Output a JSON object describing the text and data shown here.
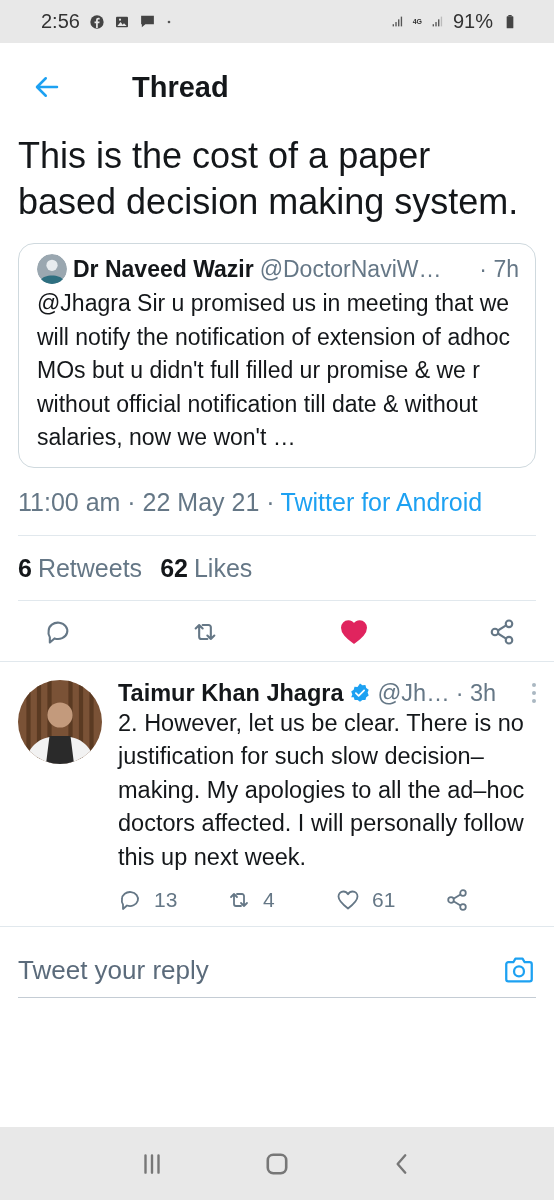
{
  "status_bar": {
    "time": "2:56",
    "network": "4G",
    "battery": "91%"
  },
  "header": {
    "title": "Thread"
  },
  "main_tweet": {
    "text": "This is the cost of a paper based decision making system.",
    "quoted_tweet": {
      "name": "Dr Naveed Wazir",
      "handle": "@DoctorNaviW…",
      "time": "· 7h",
      "text": "@Jhagra Sir u promised us in meeting that we will notify the notification of extension of adhoc MOs but u didn't full filled ur promise & we r without official notification till date & without salaries, now we won't …"
    },
    "meta": {
      "timestamp": "11:00 am · 22 May 21 ·",
      "source": "Twitter for Android"
    },
    "stats": [
      {
        "count": "6",
        "label": "Retweets"
      },
      {
        "count": "62",
        "label": "Likes"
      }
    ],
    "liked": true
  },
  "reply": {
    "name": "Taimur Khan Jhagra",
    "verified": true,
    "handle": "@Jh…",
    "time": "· 3h",
    "text": "2. However, let us be clear. There is no justification for such slow decision–making. My apologies to all the ad–hoc doctors affected. I will personally follow this up next week.",
    "actions": [
      {
        "kind": "reply",
        "count": "13"
      },
      {
        "kind": "retweet",
        "count": "4"
      },
      {
        "kind": "like",
        "count": "61"
      },
      {
        "kind": "share"
      }
    ],
    "liked": false
  },
  "compose": {
    "placeholder": "Tweet your reply"
  }
}
